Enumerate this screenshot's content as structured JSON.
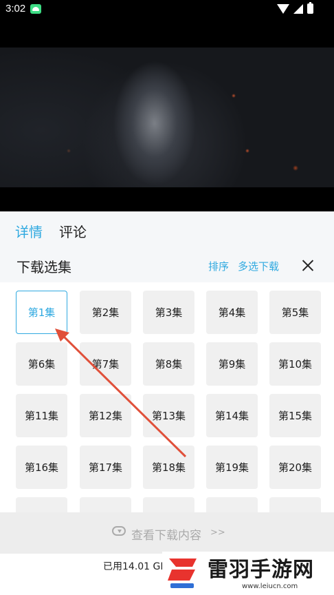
{
  "status_bar": {
    "time": "3:02"
  },
  "tabs": [
    {
      "label": "详情",
      "active": true
    },
    {
      "label": "评论",
      "active": false
    }
  ],
  "download_panel": {
    "title": "下载选集",
    "sort_label": "排序",
    "multi_select_label": "多选下载"
  },
  "episodes": [
    {
      "label": "第1集",
      "selected": true
    },
    {
      "label": "第2集"
    },
    {
      "label": "第3集"
    },
    {
      "label": "第4集"
    },
    {
      "label": "第5集"
    },
    {
      "label": "第6集"
    },
    {
      "label": "第7集"
    },
    {
      "label": "第8集"
    },
    {
      "label": "第9集"
    },
    {
      "label": "第10集"
    },
    {
      "label": "第11集"
    },
    {
      "label": "第12集"
    },
    {
      "label": "第13集"
    },
    {
      "label": "第14集"
    },
    {
      "label": "第15集"
    },
    {
      "label": "第16集"
    },
    {
      "label": "第17集"
    },
    {
      "label": "第18集"
    },
    {
      "label": "第19集"
    },
    {
      "label": "第20集"
    },
    {
      "label": ""
    },
    {
      "label": ""
    },
    {
      "label": ""
    },
    {
      "label": ""
    },
    {
      "label": ""
    }
  ],
  "view_downloads": {
    "label": "查看下载内容",
    "arrow": ">>"
  },
  "storage": {
    "text": "已用14.01 GB"
  },
  "watermark": {
    "title": "雷羽手游网",
    "url": "www.leiucn.com"
  },
  "colors": {
    "accent": "#2fa9e0",
    "arrow": "#e0503a",
    "logo_red": "#e8332e",
    "logo_blue": "#2f6fd6"
  }
}
